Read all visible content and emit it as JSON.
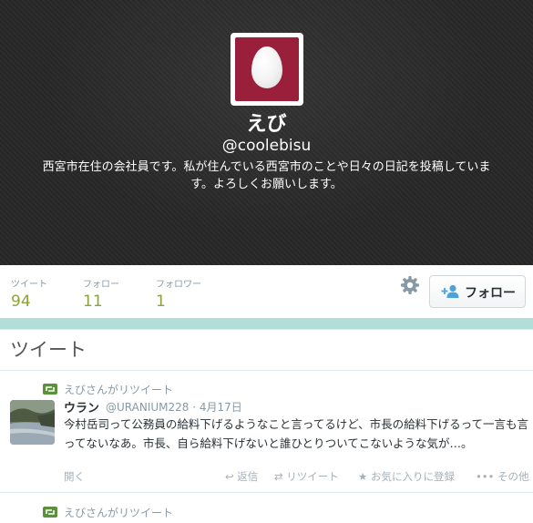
{
  "profile": {
    "display_name": "えび",
    "screen_name": "@coolebisu",
    "bio": "西宮市在住の会社員です。私が住んでいる西宮市のことや日々の日記を投稿しています。よろしくお願いします。"
  },
  "stats": [
    {
      "label": "ツイート",
      "value": "94"
    },
    {
      "label": "フォロー",
      "value": "11"
    },
    {
      "label": "フォロワー",
      "value": "1"
    }
  ],
  "actions": {
    "follow_label": "フォロー"
  },
  "timeline": {
    "title": "ツイート",
    "tweets": [
      {
        "retweeted_by": "えびさんがリツイート",
        "author_name": "ウラン",
        "author_handle": "@URANIUM228 · 4月17日",
        "text": "今村岳司って公務員の給料下げるようなこと言ってるけど、市長の給料下げるって一言も言ってないなあ。市長、自ら給料下げないと誰ひとりついてこないような気が…。",
        "open_label": "開く",
        "reply_label": "返信",
        "retweet_label": "リツイート",
        "favorite_label": "お気に入りに登録",
        "more_label": "その他"
      },
      {
        "retweeted_by": "えびさんがリツイート"
      }
    ]
  },
  "colors": {
    "avatar_bg": "#9a1f3b",
    "stat_value": "#8ca33b",
    "retweet_green": "#5c913b",
    "accent_bar": "#b3ddd9"
  }
}
